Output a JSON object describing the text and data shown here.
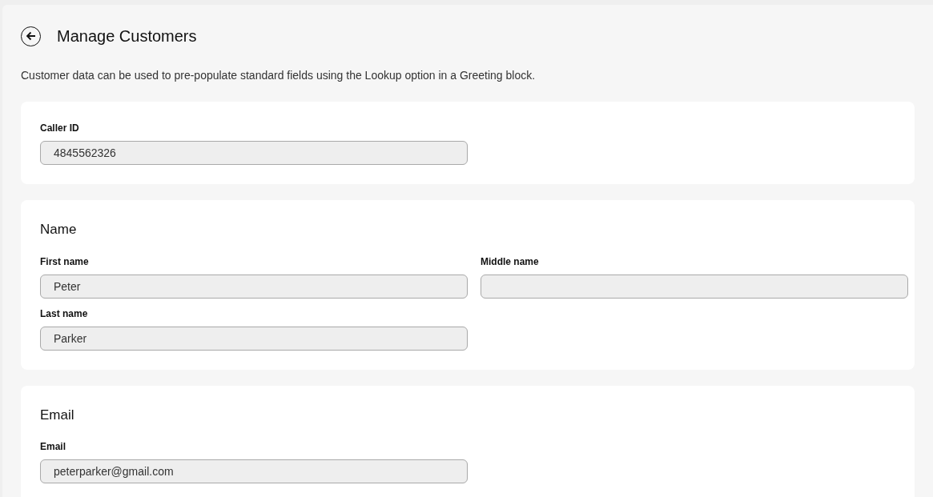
{
  "header": {
    "title": "Manage Customers",
    "description": "Customer data can be used to pre-populate standard fields using the Lookup option in a Greeting block."
  },
  "sections": [
    {
      "fields": [
        {
          "label": "Caller ID",
          "value": "4845562326",
          "disabled": true
        }
      ]
    },
    {
      "title": "Name",
      "fields": [
        {
          "label": "First name",
          "value": "Peter",
          "disabled": true
        },
        {
          "label": "Middle name",
          "disabled": true
        },
        {
          "label": "Last name",
          "value": "Parker",
          "disabled": true
        }
      ]
    },
    {
      "title": "Email",
      "fields": [
        {
          "label": "Email",
          "value": "peterparker@gmail.com",
          "disabled": true
        }
      ]
    }
  ]
}
